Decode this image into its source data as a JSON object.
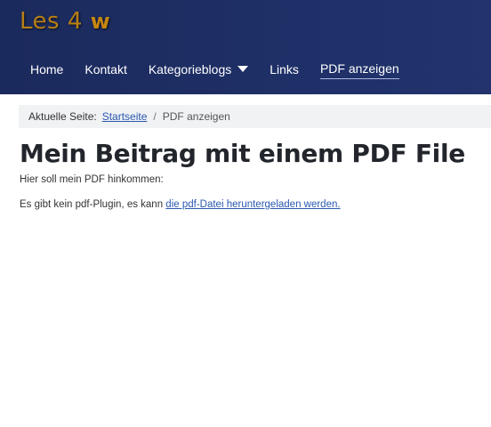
{
  "brand": {
    "part1": "Les 4 ",
    "part2": "w"
  },
  "nav": {
    "items": [
      {
        "label": "Home"
      },
      {
        "label": "Kontakt"
      },
      {
        "label": "Kategorieblogs"
      },
      {
        "label": "Links"
      },
      {
        "label": "PDF anzeigen"
      }
    ],
    "active_index": 4
  },
  "breadcrumb": {
    "prefix": "Aktuelle Seite:",
    "home_link": "Startseite",
    "separator": "/",
    "current": "PDF anzeigen"
  },
  "article": {
    "title": "Mein Beitrag mit einem PDF File",
    "paragraph1": "Hier soll mein PDF hinkommen:",
    "paragraph2_text": "Es gibt kein pdf-Plugin, es kann ",
    "paragraph2_link": "die pdf-Datei heruntergeladen werden."
  },
  "colors": {
    "header_bg": "#1f3068",
    "brand_text": "#c5860f",
    "link": "#2a58b0",
    "breadcrumb_bg": "#f1f2f4"
  }
}
